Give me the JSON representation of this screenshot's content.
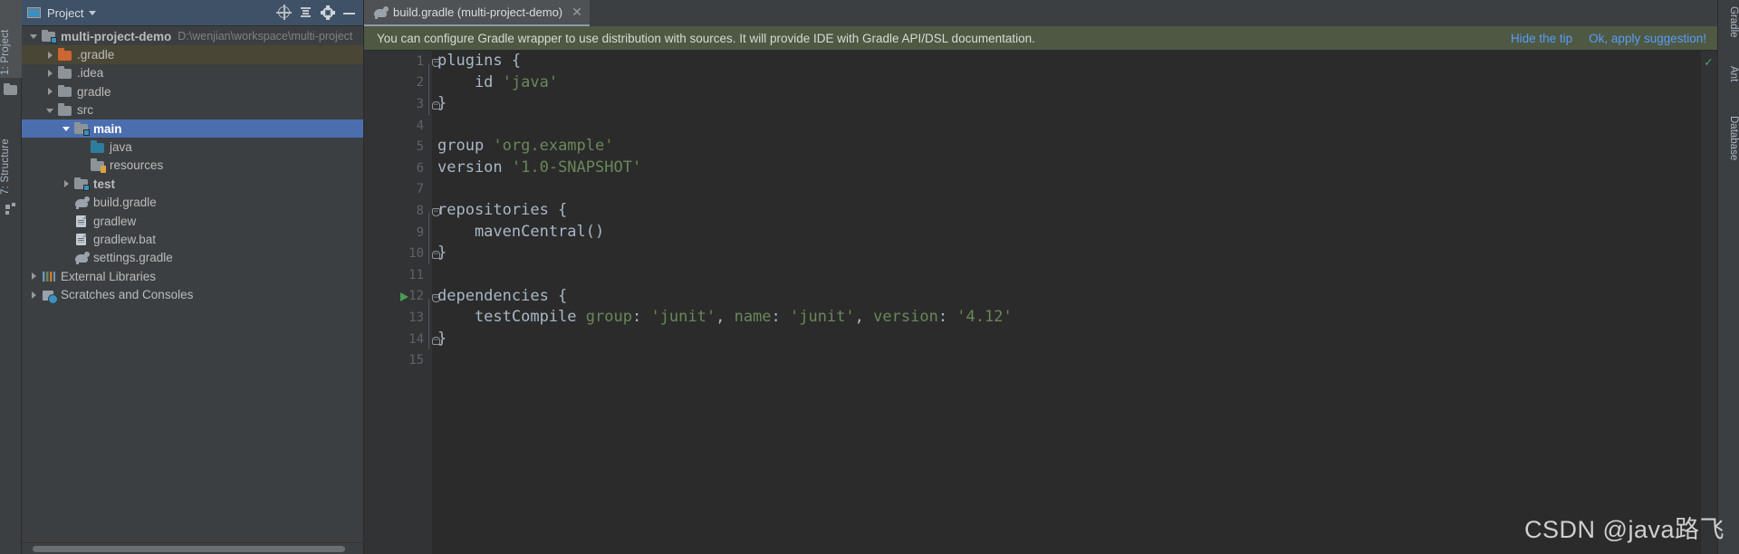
{
  "left_tool_strip": {
    "tabs": [
      {
        "label": "1: Project",
        "active": true
      },
      {
        "label": "7: Structure",
        "active": false
      }
    ],
    "icons": [
      "folder-icon",
      "structure-icon"
    ]
  },
  "right_tool_strip": {
    "tabs": [
      {
        "label": "Gradle"
      },
      {
        "label": "Ant"
      },
      {
        "label": "Database"
      }
    ]
  },
  "project_panel": {
    "title": "Project",
    "caret_icon": "chevron-down-icon",
    "toolbar_icons": [
      "locate-icon",
      "collapse-all-icon",
      "settings-gear-icon",
      "hide-icon"
    ],
    "tree": [
      {
        "label": "multi-project-demo",
        "path": "D:\\wenjian\\workspace\\multi-project",
        "indent": 0,
        "arrow": "down",
        "icon": "module-folder-icon",
        "bold": true,
        "state": "normal"
      },
      {
        "label": ".gradle",
        "path": "",
        "indent": 1,
        "arrow": "right",
        "icon": "excluded-folder-icon",
        "bold": false,
        "state": "highlighted"
      },
      {
        "label": ".idea",
        "path": "",
        "indent": 1,
        "arrow": "right",
        "icon": "folder-icon",
        "bold": false,
        "state": "normal"
      },
      {
        "label": "gradle",
        "path": "",
        "indent": 1,
        "arrow": "right",
        "icon": "folder-icon",
        "bold": false,
        "state": "normal"
      },
      {
        "label": "src",
        "path": "",
        "indent": 1,
        "arrow": "down",
        "icon": "folder-icon",
        "bold": false,
        "state": "normal"
      },
      {
        "label": "main",
        "path": "",
        "indent": 2,
        "arrow": "down",
        "icon": "source-folder-icon",
        "bold": true,
        "state": "selected"
      },
      {
        "label": "java",
        "path": "",
        "indent": 3,
        "arrow": "none",
        "icon": "java-source-folder-icon",
        "bold": false,
        "state": "normal"
      },
      {
        "label": "resources",
        "path": "",
        "indent": 3,
        "arrow": "none",
        "icon": "resources-folder-icon",
        "bold": false,
        "state": "normal"
      },
      {
        "label": "test",
        "path": "",
        "indent": 2,
        "arrow": "right",
        "icon": "test-folder-icon",
        "bold": true,
        "state": "normal"
      },
      {
        "label": "build.gradle",
        "path": "",
        "indent": 2,
        "arrow": "none",
        "icon": "gradle-file-icon",
        "bold": false,
        "state": "normal"
      },
      {
        "label": "gradlew",
        "path": "",
        "indent": 2,
        "arrow": "none",
        "icon": "file-icon",
        "bold": false,
        "state": "normal"
      },
      {
        "label": "gradlew.bat",
        "path": "",
        "indent": 2,
        "arrow": "none",
        "icon": "file-icon",
        "bold": false,
        "state": "normal"
      },
      {
        "label": "settings.gradle",
        "path": "",
        "indent": 2,
        "arrow": "none",
        "icon": "gradle-file-icon",
        "bold": false,
        "state": "normal"
      },
      {
        "label": "External Libraries",
        "path": "",
        "indent": 0,
        "arrow": "right",
        "icon": "libraries-icon",
        "bold": false,
        "state": "normal"
      },
      {
        "label": "Scratches and Consoles",
        "path": "",
        "indent": 0,
        "arrow": "right",
        "icon": "scratches-icon",
        "bold": false,
        "state": "normal"
      }
    ]
  },
  "editor": {
    "tab": {
      "label": "build.gradle (multi-project-demo)",
      "icon": "gradle-file-icon",
      "close_icon": "close-icon"
    },
    "tip": {
      "text": "You can configure Gradle wrapper to use distribution with sources. It will provide IDE with Gradle API/DSL documentation.",
      "hide_label": "Hide the tip",
      "apply_label": "Ok, apply suggestion!",
      "link_color": "#589df6",
      "background": "#4e5843"
    },
    "status_icon": "inspection-ok-check-icon",
    "line_numbers": [
      "1",
      "2",
      "3",
      "4",
      "5",
      "6",
      "7",
      "8",
      "9",
      "10",
      "11",
      "12",
      "13",
      "14",
      "15"
    ],
    "run_marker_line": 12,
    "code_lines": [
      {
        "n": 1,
        "tokens": [
          {
            "t": "plugins {",
            "c": "kw"
          }
        ],
        "fold": "open"
      },
      {
        "n": 2,
        "tokens": [
          {
            "t": "    id ",
            "c": "kw"
          },
          {
            "t": "'java'",
            "c": "str"
          }
        ],
        "fold": ""
      },
      {
        "n": 3,
        "tokens": [
          {
            "t": "}",
            "c": "kw"
          }
        ],
        "fold": "close"
      },
      {
        "n": 4,
        "tokens": [],
        "fold": ""
      },
      {
        "n": 5,
        "tokens": [
          {
            "t": "group ",
            "c": "kw"
          },
          {
            "t": "'org.example'",
            "c": "str"
          }
        ],
        "fold": ""
      },
      {
        "n": 6,
        "tokens": [
          {
            "t": "version ",
            "c": "kw"
          },
          {
            "t": "'1.0-SNAPSHOT'",
            "c": "str"
          }
        ],
        "fold": ""
      },
      {
        "n": 7,
        "tokens": [],
        "fold": ""
      },
      {
        "n": 8,
        "tokens": [
          {
            "t": "repositories {",
            "c": "kw"
          }
        ],
        "fold": "open"
      },
      {
        "n": 9,
        "tokens": [
          {
            "t": "    mavenCentral()",
            "c": "kw"
          }
        ],
        "fold": ""
      },
      {
        "n": 10,
        "tokens": [
          {
            "t": "}",
            "c": "kw"
          }
        ],
        "fold": "close"
      },
      {
        "n": 11,
        "tokens": [],
        "fold": ""
      },
      {
        "n": 12,
        "tokens": [
          {
            "t": "dependencies {",
            "c": "kw"
          }
        ],
        "fold": "open"
      },
      {
        "n": 13,
        "tokens": [
          {
            "t": "    testCompile ",
            "c": "kw"
          },
          {
            "t": "group",
            "c": "lbl"
          },
          {
            "t": ": ",
            "c": "kw"
          },
          {
            "t": "'junit'",
            "c": "str"
          },
          {
            "t": ", ",
            "c": "kw"
          },
          {
            "t": "name",
            "c": "lbl"
          },
          {
            "t": ": ",
            "c": "kw"
          },
          {
            "t": "'junit'",
            "c": "str"
          },
          {
            "t": ", ",
            "c": "kw"
          },
          {
            "t": "version",
            "c": "lbl"
          },
          {
            "t": ": ",
            "c": "kw"
          },
          {
            "t": "'4.12'",
            "c": "str"
          }
        ],
        "fold": ""
      },
      {
        "n": 14,
        "tokens": [
          {
            "t": "}",
            "c": "kw"
          }
        ],
        "fold": "close"
      },
      {
        "n": 15,
        "tokens": [],
        "fold": ""
      }
    ]
  },
  "watermark": {
    "text": "CSDN @java路飞"
  },
  "theme": {
    "editor_bg": "#2b2b2b",
    "panel_bg": "#3c3f41",
    "selection_blue": "#4b6eaf",
    "header_blue": "#3f5166",
    "string_green": "#6a8759",
    "number_blue": "#6897bb",
    "text_gray": "#a9b7c6"
  }
}
